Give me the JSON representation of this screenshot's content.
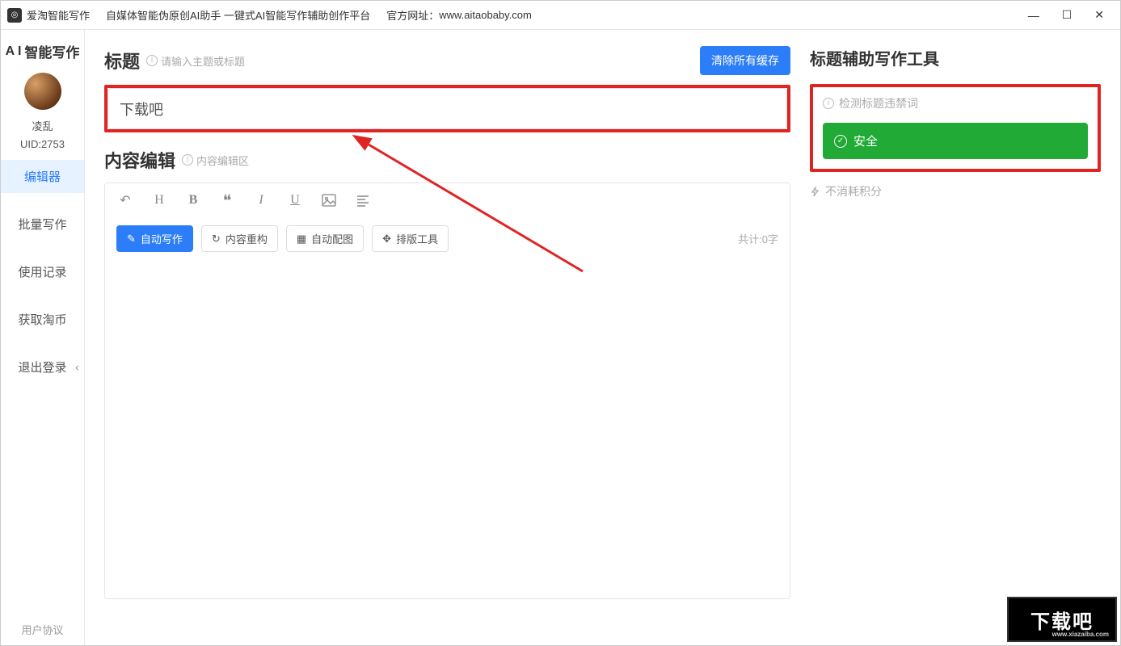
{
  "titlebar": {
    "app_name": "爱淘智能写作",
    "description": "自媒体智能伪原创AI助手    一键式AI智能写作辅助创作平台",
    "site_label": "官方网址：",
    "site_url": "www.aitaobaby.com"
  },
  "sidebar": {
    "logo_prefix": "A I",
    "logo_text": "智能写作",
    "username": "凌乱",
    "uid": "UID:2753",
    "nav": [
      {
        "label": "编辑器",
        "active": true
      },
      {
        "label": "批量写作",
        "active": false
      },
      {
        "label": "使用记录",
        "active": false
      },
      {
        "label": "获取淘币",
        "active": false
      },
      {
        "label": "退出登录",
        "active": false
      }
    ],
    "footer": "用户协议"
  },
  "main": {
    "title_section": {
      "heading": "标题",
      "hint": "请输入主题或标题",
      "clear_button": "清除所有缓存",
      "title_value": "下载吧"
    },
    "content_section": {
      "heading": "内容编辑",
      "hint": "内容编辑区",
      "actions": {
        "auto_write": "自动写作",
        "restructure": "内容重构",
        "auto_image": "自动配图",
        "layout_tool": "排版工具"
      },
      "word_count": "共计:0字"
    }
  },
  "assist": {
    "heading": "标题辅助写作工具",
    "check_label": "检测标题违禁词",
    "safe_text": "安全",
    "points_text": "不消耗积分"
  },
  "watermark": {
    "text": "下载吧",
    "sub": "www.xiazaiba.com"
  }
}
